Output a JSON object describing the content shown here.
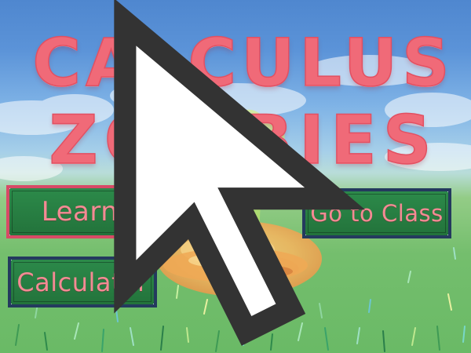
{
  "title": {
    "line1": "CALCULUS",
    "line2": "ZOMBIES"
  },
  "menu": {
    "learn_label": "Learn",
    "go_to_class_label": "Go to Class",
    "calculator_label": "Calculator",
    "selected": "Learn"
  },
  "colors": {
    "title_text": "#f06a78",
    "button_fill": "#2c8a4a",
    "button_border": "#243a5e",
    "selected_border": "#d84a66",
    "button_text": "#f48a94",
    "sky_top": "#4f87cf",
    "grass": "#74be6d",
    "zombie_hand": "#b9e27a",
    "dirt_mound": "#f2b660"
  },
  "icons": {
    "cursor": "mouse-pointer-icon",
    "hand": "zombie-hand-icon"
  }
}
